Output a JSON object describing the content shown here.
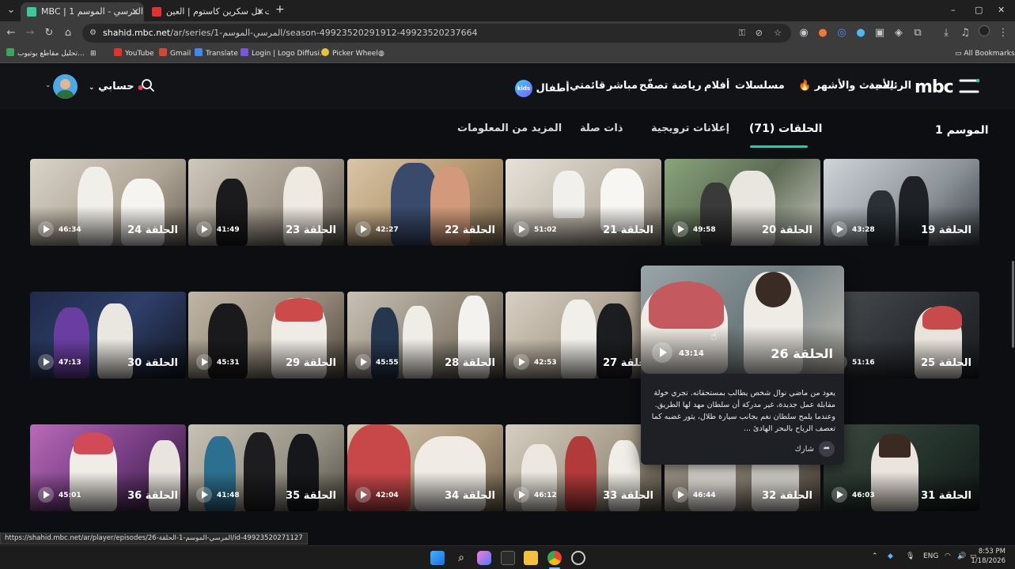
{
  "browser": {
    "tabs": [
      {
        "title": "MBC | شاهد المرسي - الموسم 1",
        "active": true
      },
      {
        "title": "البرت فل سكرين كاستوم | العين",
        "active": false
      }
    ],
    "new_tab_label": "+",
    "url_host": "shahid.mbc.net",
    "url_path": "/ar/series/المرسي-الموسم-1/season-49923520291912-49923520237664",
    "bookmarks": [
      "تحليل مقاطع يوتيوب...",
      "YouTube",
      "Gmail",
      "Translate",
      "Login | Logo Diffusi...",
      "Picker Wheel"
    ],
    "all_bookmarks": "All Bookmarks",
    "window_controls": [
      "–",
      "▢",
      "✕"
    ]
  },
  "site": {
    "logo": "mbc",
    "nav": [
      "الرئيسية",
      "الأحدث والأشهر",
      "مسلسلات",
      "أفلام",
      "رياضة",
      "تصفّح",
      "مباشر",
      "قائمتي",
      "أطفال"
    ],
    "kids_badge": "kids",
    "account_label": "حسابي",
    "season_label": "الموسم 1",
    "content_tabs": [
      {
        "label": "الحلقات (71)",
        "active": true
      },
      {
        "label": "إعلانات ترويجية",
        "active": false
      },
      {
        "label": "ذات صلة",
        "active": false
      },
      {
        "label": "المزيد من المعلومات",
        "active": false
      }
    ]
  },
  "episodes": [
    {
      "title": "الحلقة 19",
      "duration": "43:28"
    },
    {
      "title": "الحلقة 20",
      "duration": "49:58"
    },
    {
      "title": "الحلقة 21",
      "duration": "51:02"
    },
    {
      "title": "الحلقة 22",
      "duration": "42:27"
    },
    {
      "title": "الحلقة 23",
      "duration": "41:49"
    },
    {
      "title": "الحلقة 24",
      "duration": "46:34"
    },
    {
      "title": "الحلقة 25",
      "duration": "51:16"
    },
    {
      "title": "الحلقة 27",
      "duration": "42:53"
    },
    {
      "title": "الحلقة 28",
      "duration": "45:55"
    },
    {
      "title": "الحلقة 29",
      "duration": "45:31"
    },
    {
      "title": "الحلقة 30",
      "duration": "47:13"
    },
    {
      "title": "الحلقة 31",
      "duration": "46:03"
    },
    {
      "title": "الحلقة 32",
      "duration": "46:44"
    },
    {
      "title": "الحلقة 33",
      "duration": "46:12"
    },
    {
      "title": "الحلقة 34",
      "duration": "42:04"
    },
    {
      "title": "الحلقة 35",
      "duration": "41:48"
    },
    {
      "title": "الحلقة 36",
      "duration": "45:01"
    }
  ],
  "popup": {
    "title": "الحلقة 26",
    "duration": "43:14",
    "description": "يعود من ماضي نوال شخص يطالب بمستحقاته. تجري خولة مقابلة عمل جديدة، غير مدركة أن سلطان مهد لها الطريق. وعندما يلمح سلطان نغم بجانب سيارة طلال، يثور غضبه كما تعصف الرياح بالبحر الهادئ ...",
    "share_label": "شارك"
  },
  "status_url": "https://shahid.mbc.net/ar/player/episodes/المرسي-الموسم-1-الحلقة-26/id-49923520271127",
  "taskbar": {
    "lang": "ENG",
    "time": "8:53 PM",
    "date": "1/18/2026"
  },
  "colors": {
    "accent": "#35c3a9",
    "background": "#0d0e12"
  }
}
